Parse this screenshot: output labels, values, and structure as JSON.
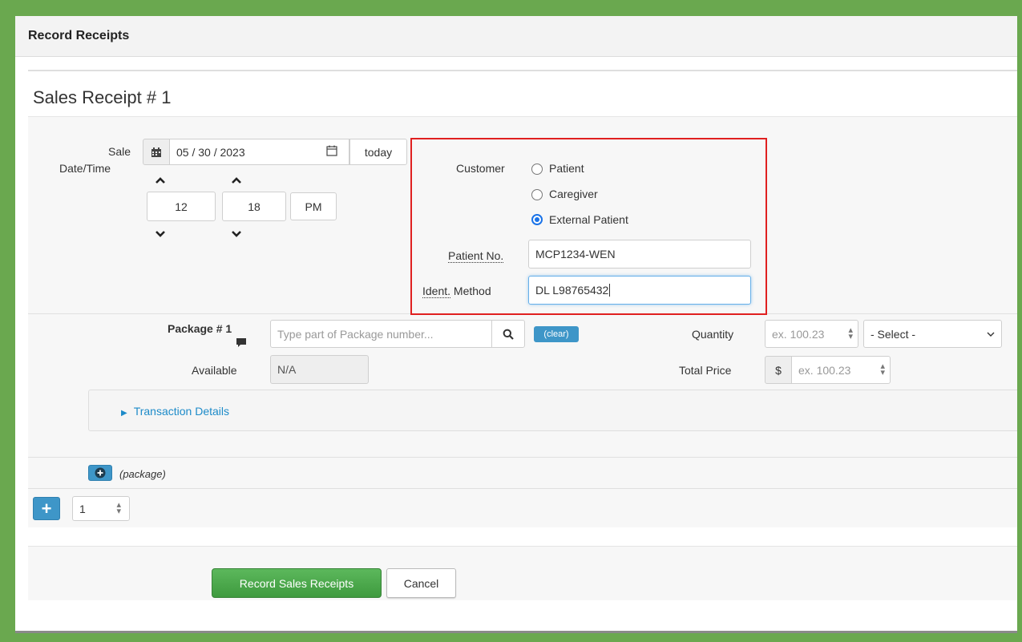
{
  "modal": {
    "title": "Record Receipts"
  },
  "receipt": {
    "title": "Sales Receipt # 1"
  },
  "sale": {
    "label_line1": "Sale",
    "label_line2": "Date/Time",
    "date_value": "05 / 30 / 2023",
    "today_label": "today",
    "hour": "12",
    "minute": "18",
    "separator": ":",
    "ampm": "PM"
  },
  "customer": {
    "label": "Customer",
    "options": [
      "Patient",
      "Caregiver",
      "External Patient"
    ],
    "selected": "External Patient",
    "patient_no_label": "Patient No.",
    "patient_no_value": "MCP1234-WEN",
    "ident_label_abbr": "Ident.",
    "ident_label_rest": " Method",
    "ident_value": "DL L98765432"
  },
  "package": {
    "label": "Package # 1",
    "search_placeholder": "Type part of Package number...",
    "clear_label": "(clear)",
    "available_label": "Available",
    "available_value": "N/A",
    "quantity_label": "Quantity",
    "quantity_placeholder": "ex. 100.23",
    "unit_select": "- Select -",
    "total_price_label": "Total Price",
    "currency": "$",
    "price_placeholder": "ex. 100.23"
  },
  "transaction": {
    "label": "Transaction Details"
  },
  "add_package": {
    "label": "(package)"
  },
  "add_receipts": {
    "count": "1"
  },
  "footer": {
    "record_label": "Record Sales Receipts",
    "cancel_label": "Cancel"
  },
  "colors": {
    "frame": "#6aa84f",
    "highlight": "#e02020",
    "link": "#1d8bc9",
    "primary": "#3e96c8",
    "success": "#5cb85c"
  }
}
